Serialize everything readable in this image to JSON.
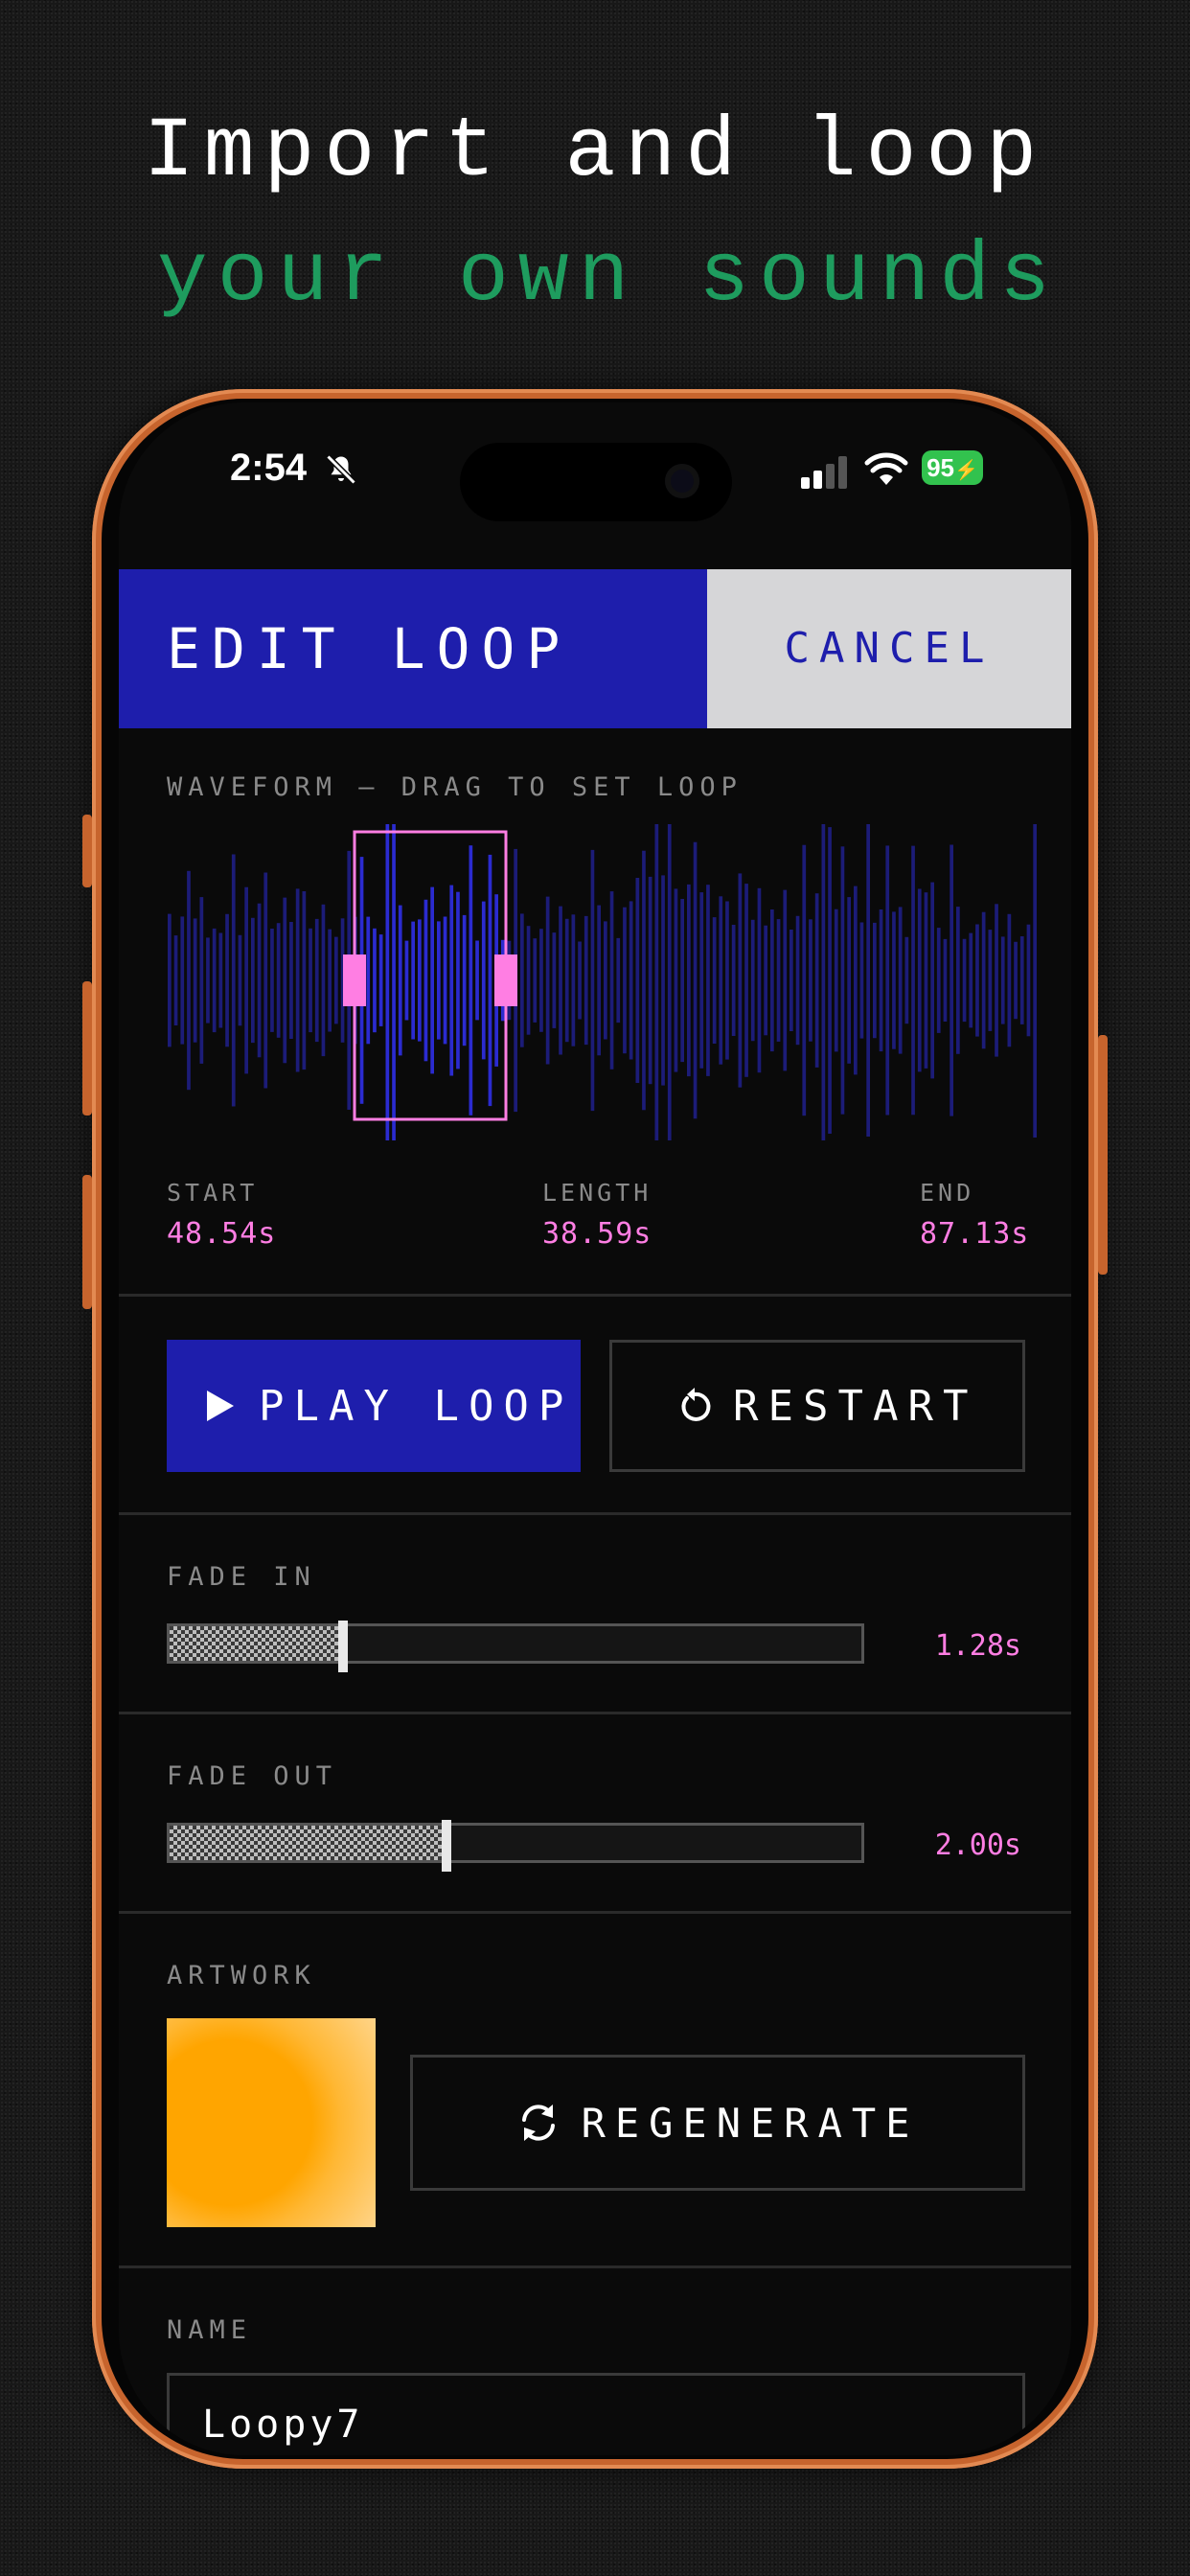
{
  "promo": {
    "line1": "Import and loop",
    "line2": "your own sounds"
  },
  "status_bar": {
    "time": "2:54",
    "battery": "95"
  },
  "header": {
    "title": "EDIT LOOP",
    "cancel": "CANCEL"
  },
  "waveform": {
    "label": "WAVEFORM — DRAG TO SET LOOP"
  },
  "loop_info": {
    "start_label": "START",
    "start_value": "48.54s",
    "length_label": "LENGTH",
    "length_value": "38.59s",
    "end_label": "END",
    "end_value": "87.13s"
  },
  "controls": {
    "play": "PLAY LOOP",
    "restart": "RESTART"
  },
  "fade_in": {
    "label": "FADE IN",
    "value": "1.28s",
    "level": 0.25
  },
  "fade_out": {
    "label": "FADE OUT",
    "value": "2.00s",
    "level": 0.4
  },
  "artwork": {
    "label": "ARTWORK",
    "regenerate": "REGENERATE"
  },
  "name": {
    "label": "NAME",
    "value": "Loopy7"
  },
  "colors": {
    "accent": "#1e1eac",
    "highlight": "#ff7ee3",
    "promo_green": "#1e9c5e",
    "artwork": "#ffa500"
  }
}
